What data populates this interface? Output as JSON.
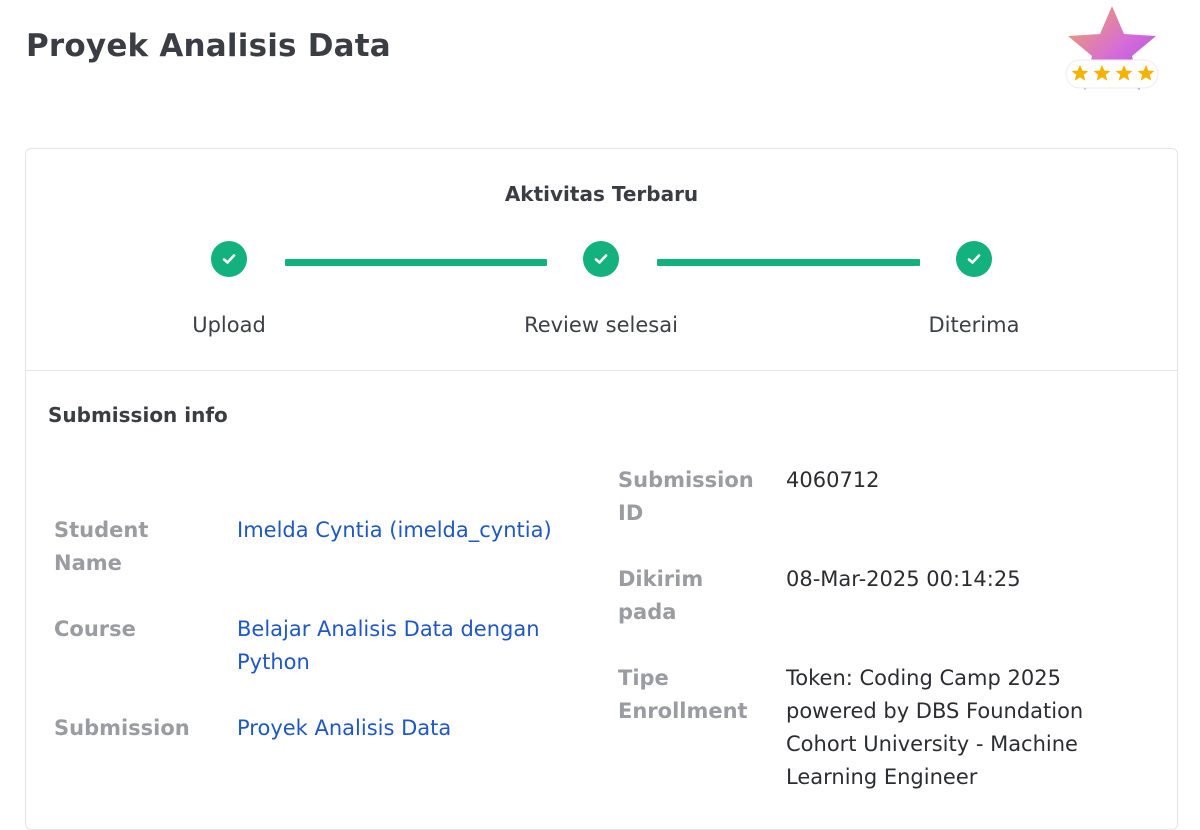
{
  "page": {
    "title": "Proyek Analisis Data"
  },
  "badge": {
    "icon": "star-rating-badge-icon",
    "stars": 4,
    "colors": {
      "star_gradient": [
        "#f2a65a",
        "#d56bd9",
        "#9b4fe0"
      ],
      "rating_star": "#f5b301"
    }
  },
  "activity": {
    "title": "Aktivitas Terbaru",
    "steps": [
      {
        "label": "Upload",
        "status": "done"
      },
      {
        "label": "Review selesai",
        "status": "done"
      },
      {
        "label": "Diterima",
        "status": "done"
      }
    ],
    "accent_color": "#12b17d"
  },
  "submission_info": {
    "title": "Submission info",
    "left": {
      "student_name_label": "Student Name",
      "student_name_value": "Imelda Cyntia (imelda_cyntia)",
      "course_label": "Course",
      "course_value": "Belajar Analisis Data dengan Python",
      "submission_label": "Submission",
      "submission_value": "Proyek Analisis Data"
    },
    "right": {
      "submission_id_label": "Submission ID",
      "submission_id_value": "4060712",
      "dikirim_label": "Dikirim pada",
      "dikirim_value": "08-Mar-2025 00:14:25",
      "tipe_label": "Tipe Enrollment",
      "tipe_value": "Token: Coding Camp 2025 powered by DBS Foundation Cohort University - Machine Learning Engineer"
    },
    "link_color": "#1f57c3"
  }
}
